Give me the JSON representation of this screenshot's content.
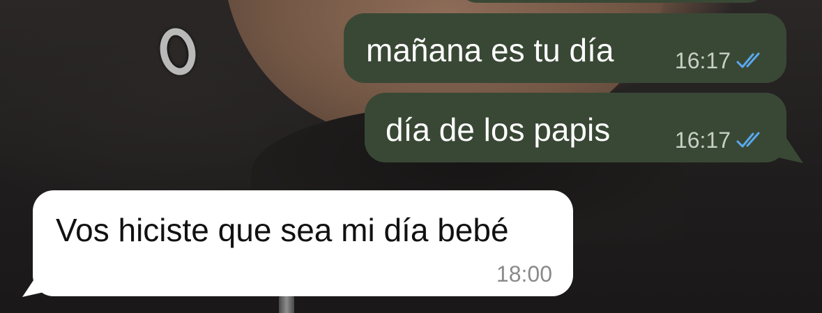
{
  "chat": {
    "messages": [
      {
        "direction": "outgoing",
        "text": "mañana es tu día",
        "time": "16:17",
        "status": "read"
      },
      {
        "direction": "outgoing",
        "text": "día de los papis",
        "time": "16:17",
        "status": "read"
      },
      {
        "direction": "incoming",
        "text": "Vos hiciste que sea mi día bebé",
        "time": "18:00"
      }
    ]
  },
  "colors": {
    "outgoing_bubble": "#394835",
    "incoming_bubble": "#ffffff",
    "read_check": "#5aa9f0"
  },
  "icons": {
    "read_status": "double-check-icon"
  }
}
